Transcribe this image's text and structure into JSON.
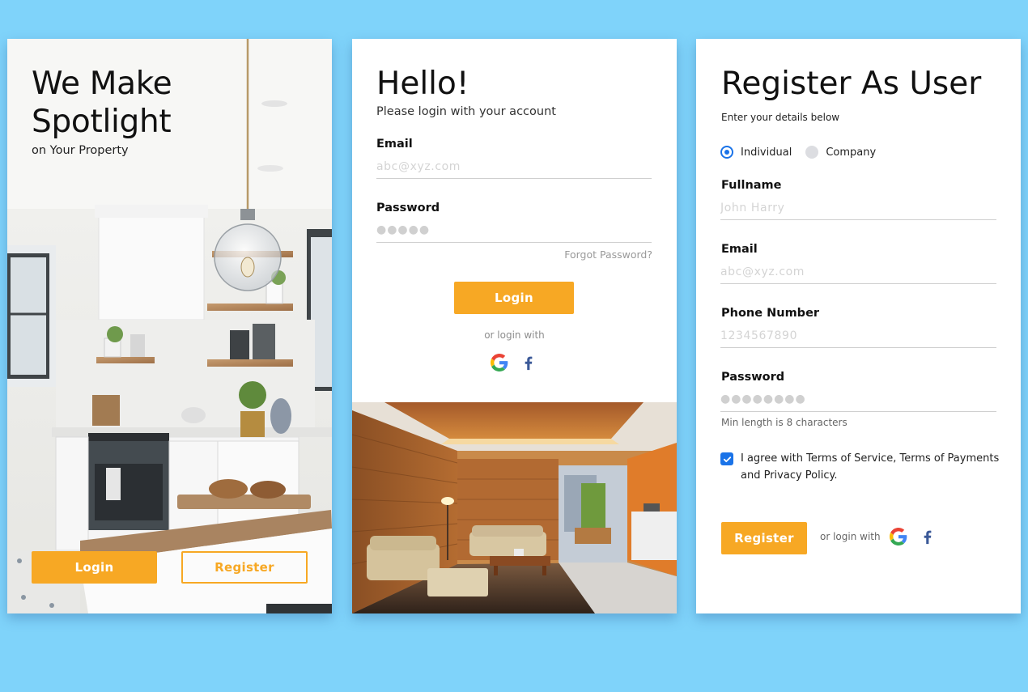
{
  "colors": {
    "background": "#7fd3fa",
    "accent": "#f7a824",
    "checkbox": "#1a73e8"
  },
  "card_welcome": {
    "title": "We Make Spotlight",
    "subtitle": "on Your Property",
    "login_label": "Login",
    "register_label": "Register"
  },
  "card_login": {
    "title": "Hello!",
    "subtitle": "Please login with your account",
    "email_label": "Email",
    "email_placeholder": "abc@xyz.com",
    "password_label": "Password",
    "password_mask": "●●●●●",
    "forgot_label": "Forgot Password?",
    "login_label": "Login",
    "or_login": "or login with",
    "social_icons": [
      "google-icon",
      "facebook-icon"
    ]
  },
  "card_register": {
    "title": "Register As User",
    "subtitle": "Enter your details below",
    "account_types": [
      {
        "label": "Individual",
        "selected": true
      },
      {
        "label": "Company",
        "selected": false
      }
    ],
    "fullname_label": "Fullname",
    "fullname_placeholder": "John Harry",
    "email_label": "Email",
    "email_placeholder": "abc@xyz.com",
    "phone_label": "Phone Number",
    "phone_placeholder": "1234567890",
    "password_label": "Password",
    "password_mask": "●●●●●●●●",
    "password_hint": "Min length is 8 characters",
    "agree_text": "I agree with Terms of Service, Terms of Payments and Privacy Policy.",
    "agree_checked": true,
    "register_label": "Register",
    "or_login": "or login with",
    "social_icons": [
      "google-icon",
      "facebook-icon"
    ]
  }
}
